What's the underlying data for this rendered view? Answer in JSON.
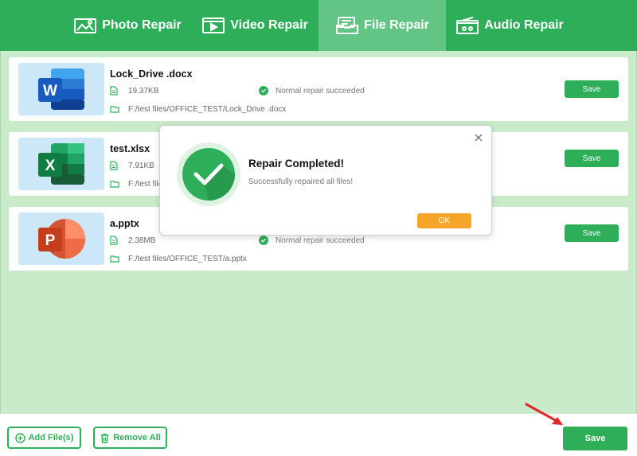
{
  "tabs": [
    {
      "label": "Photo Repair",
      "icon": "photo-icon",
      "active": false
    },
    {
      "label": "Video Repair",
      "icon": "video-icon",
      "active": false
    },
    {
      "label": "File Repair",
      "icon": "file-icon",
      "active": true
    },
    {
      "label": "Audio Repair",
      "icon": "audio-icon",
      "active": false
    }
  ],
  "files": [
    {
      "name": "Lock_Drive .docx",
      "size": "19.37KB",
      "path": "F:/test files/OFFICE_TEST/Lock_Drive .docx",
      "status": "Normal repair succeeded",
      "save_label": "Save",
      "type_icon": "word-icon"
    },
    {
      "name": "test.xlsx",
      "size": "7.91KB",
      "path": "F:/test files/",
      "status": "",
      "save_label": "Save",
      "type_icon": "excel-icon"
    },
    {
      "name": "a.pptx",
      "size": "2.38MB",
      "path": "F:/test files/OFFICE_TEST/a.pptx",
      "status": "Normal repair succeeded",
      "save_label": "Save",
      "type_icon": "powerpoint-icon"
    }
  ],
  "dialog": {
    "title": "Repair Completed!",
    "message": "Successfully repaired all files!",
    "ok_label": "OK"
  },
  "bottom": {
    "add_label": "Add File(s)",
    "remove_label": "Remove All",
    "save_label": "Save"
  },
  "colors": {
    "brand_green": "#2fae5a",
    "active_tab": "#62c585",
    "panel_bg": "#c9ebc9",
    "ok_orange": "#f7a42a",
    "arrow_red": "#e0262b"
  }
}
